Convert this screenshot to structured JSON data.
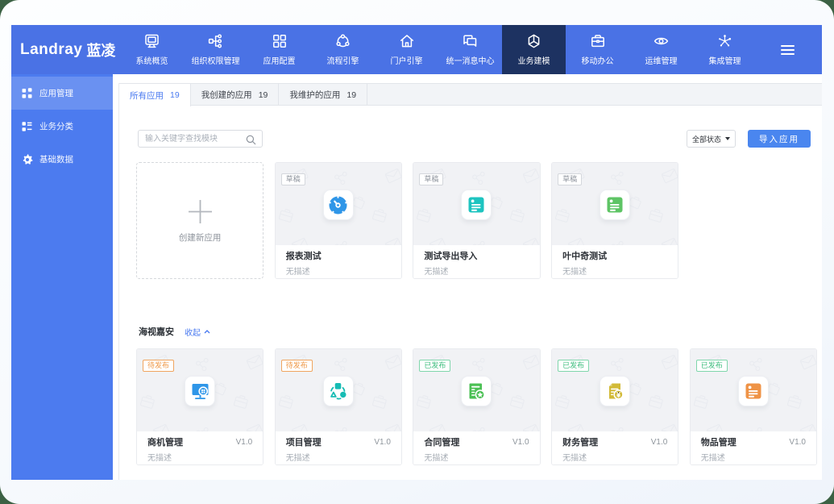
{
  "page": {
    "background_color": "#3c6144",
    "window_color": "#f4f7fc"
  },
  "header": {
    "logo_en": "Landray",
    "logo_cn": "蓝凌",
    "accent_color": "#4a72e5",
    "active_item_color": "#1d3261",
    "nav": [
      {
        "label": "系统概览",
        "icon": "monitor-icon",
        "active": false
      },
      {
        "label": "组织权限管理",
        "icon": "org-tree-icon",
        "active": false
      },
      {
        "label": "应用配置",
        "icon": "grid-icon",
        "active": false
      },
      {
        "label": "流程引擎",
        "icon": "cycle-icon",
        "active": false
      },
      {
        "label": "门户引擎",
        "icon": "home-icon",
        "active": false
      },
      {
        "label": "统一消息中心",
        "icon": "chat-icon",
        "active": false
      },
      {
        "label": "业务建模",
        "icon": "cube-icon",
        "active": true
      },
      {
        "label": "移动办公",
        "icon": "briefcase-icon",
        "active": false
      },
      {
        "label": "运维管理",
        "icon": "eye-icon",
        "active": false
      },
      {
        "label": "集成管理",
        "icon": "nodes-icon",
        "active": false
      }
    ],
    "menu_icon": "hamburger-icon"
  },
  "sidebar": {
    "items": [
      {
        "label": "应用管理",
        "icon": "apps-icon",
        "active": true
      },
      {
        "label": "业务分类",
        "icon": "category-icon",
        "active": false
      },
      {
        "label": "基础数据",
        "icon": "gear-icon",
        "active": false
      }
    ]
  },
  "tabs": [
    {
      "label": "所有应用",
      "count": "19",
      "active": true
    },
    {
      "label": "我创建的应用",
      "count": "19",
      "active": false
    },
    {
      "label": "我维护的应用",
      "count": "19",
      "active": false
    }
  ],
  "toolbar": {
    "search_placeholder": "输入关键字查找模块",
    "search_icon": "magnifier-icon",
    "status_filter_value": "全部状态",
    "import_button_label": "导入应用",
    "button_color": "#4a86ef"
  },
  "create_card": {
    "label": "创建新应用",
    "icon": "plus-icon"
  },
  "sections": [
    {
      "title": "",
      "collapse_label": "",
      "cards": [
        {
          "title": "报表测试",
          "tag": "草稿",
          "tag_type": "draft",
          "desc": "无描述",
          "version": "",
          "icon": "gauge-icon",
          "icon_color": "#2f96e8"
        },
        {
          "title": "测试导出导入",
          "tag": "草稿",
          "tag_type": "draft",
          "desc": "无描述",
          "version": "",
          "icon": "note-icon",
          "icon_color": "#1ec4c0"
        },
        {
          "title": "叶中奇测试",
          "tag": "草稿",
          "tag_type": "draft",
          "desc": "无描述",
          "version": "",
          "icon": "note-icon",
          "icon_color": "#5ec465"
        }
      ]
    },
    {
      "title": "海视嘉安",
      "collapse_label": "收起",
      "collapse_icon": "chevron-up-icon",
      "cards": [
        {
          "title": "商机管理",
          "tag": "待发布",
          "tag_type": "pending",
          "desc": "无描述",
          "version": "V1.0",
          "icon": "monitor-grid-icon",
          "icon_color": "#2f96e8"
        },
        {
          "title": "项目管理",
          "tag": "待发布",
          "tag_type": "pending",
          "desc": "无描述",
          "version": "V1.0",
          "icon": "project-cycle-icon",
          "icon_color": "#16bcb4"
        },
        {
          "title": "合同管理",
          "tag": "已发布",
          "tag_type": "published",
          "desc": "无描述",
          "version": "V1.0",
          "icon": "doc-star-icon",
          "icon_color": "#4bc054"
        },
        {
          "title": "财务管理",
          "tag": "已发布",
          "tag_type": "published",
          "desc": "无描述",
          "version": "V1.0",
          "icon": "doc-yen-icon",
          "icon_color": "#d2ba37"
        },
        {
          "title": "物品管理",
          "tag": "已发布",
          "tag_type": "published",
          "desc": "无描述",
          "version": "V1.0",
          "icon": "note-icon",
          "icon_color": "#ef9346"
        }
      ]
    }
  ]
}
